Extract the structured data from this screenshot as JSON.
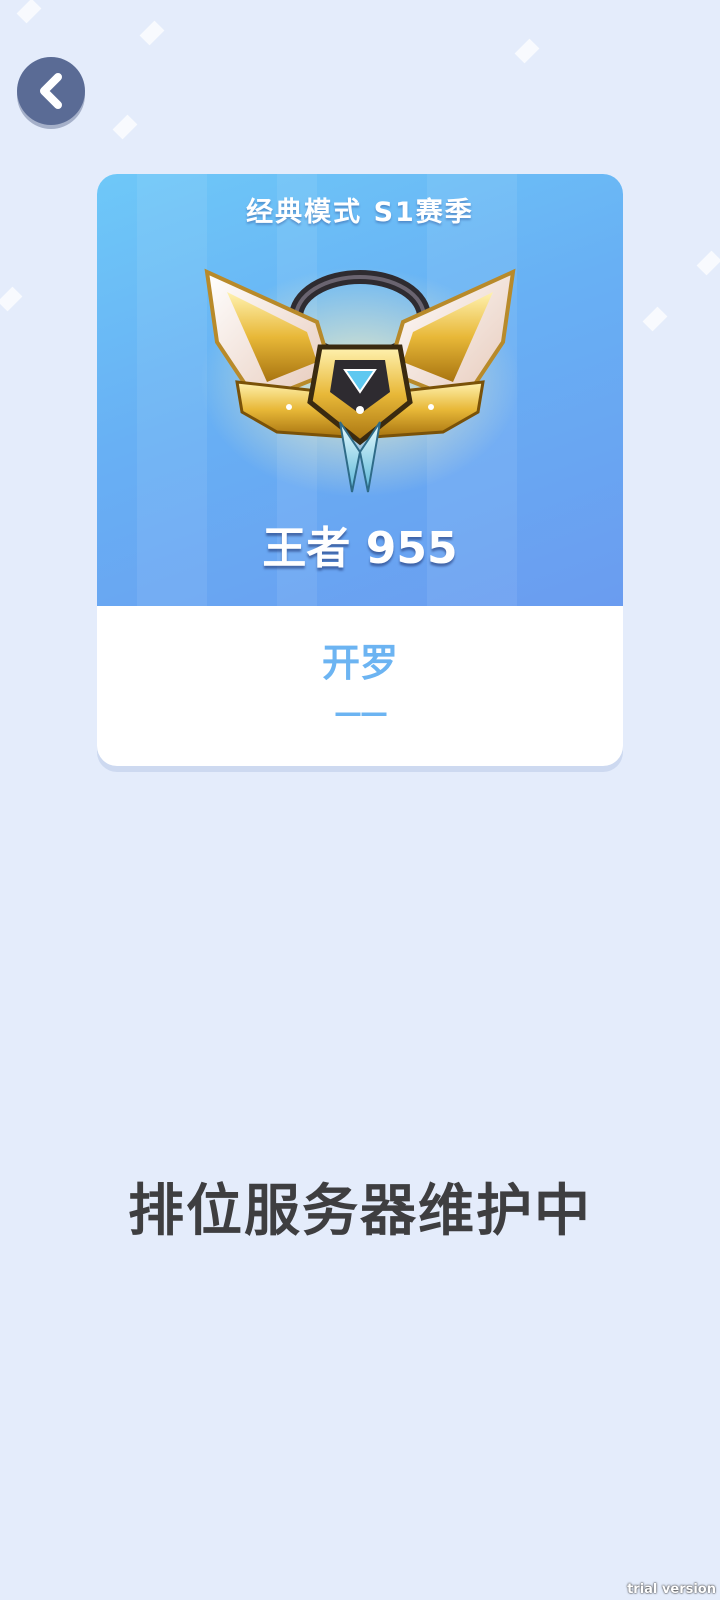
{
  "navigation": {
    "back_icon": "chevron-left-icon"
  },
  "rank_card": {
    "season_title": "经典模式 S1赛季",
    "emblem_icon": "king-rank-emblem-icon",
    "rank_score": "王者 955",
    "city": "开罗",
    "city_rank": "——"
  },
  "status": {
    "message": "排位服务器维护中"
  },
  "watermark": "trial version",
  "colors": {
    "background": "#e4ecfb",
    "card_gradient_start": "#6ec8f8",
    "card_gradient_end": "#6a9cf0",
    "city_text": "#6cb4f2",
    "status_text": "#3e3e40",
    "back_button": "#5a6b95"
  }
}
